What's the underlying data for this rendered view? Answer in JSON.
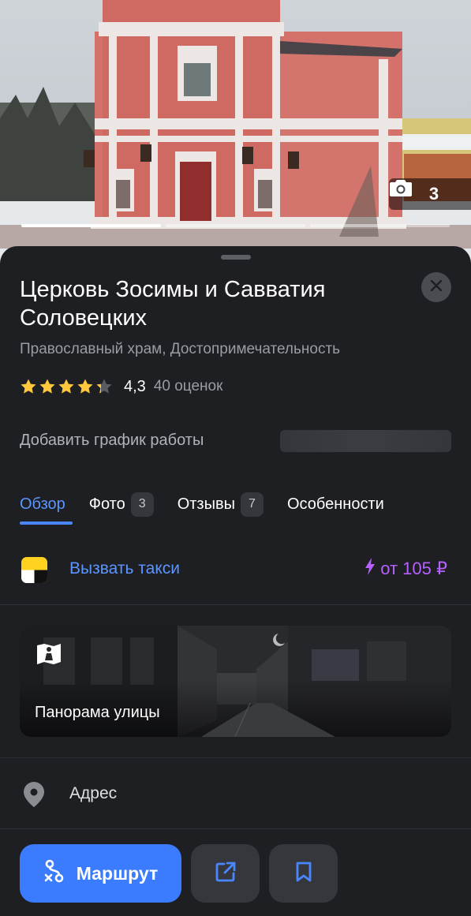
{
  "hero": {
    "photo_count": "3"
  },
  "place": {
    "title": "Церковь Зосимы и Савватия Соловецких",
    "category": "Православный храм, Достопримечательность",
    "rating": "4,3",
    "rating_stars": 4.3,
    "rating_count": "40 оценок",
    "hours_label": "Добавить график работы"
  },
  "tabs": [
    {
      "label": "Обзор",
      "badge": ""
    },
    {
      "label": "Фото",
      "badge": "3"
    },
    {
      "label": "Отзывы",
      "badge": "7"
    },
    {
      "label": "Особенности",
      "badge": ""
    }
  ],
  "taxi": {
    "label": "Вызвать такси",
    "price": "от 105 ₽"
  },
  "panorama": {
    "label": "Панорама улицы"
  },
  "address": {
    "label": "Адрес"
  },
  "actions": {
    "route_label": "Маршрут"
  },
  "colors": {
    "accent": "#3b7cff",
    "link": "#5b95ff",
    "taxi_price": "#b560ff",
    "star": "#ffc83d",
    "background": "#1e1f23"
  },
  "icons": [
    "camera-icon",
    "close-icon",
    "star-icon",
    "taxi-icon",
    "lightning-icon",
    "panorama-icon",
    "location-pin-icon",
    "route-icon",
    "share-icon",
    "bookmark-icon"
  ]
}
